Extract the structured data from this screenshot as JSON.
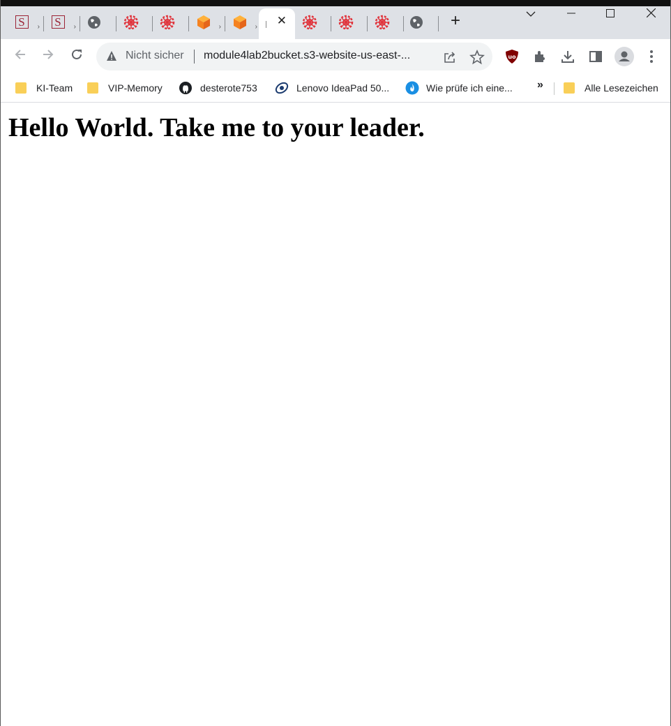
{
  "browser": {
    "tabs": [
      {
        "icon": "s-logo-icon",
        "title": "S",
        "active": false
      },
      {
        "icon": "s-logo-icon",
        "title": "S",
        "active": false
      },
      {
        "icon": "globe-icon",
        "title": "",
        "active": false
      },
      {
        "icon": "aws-wheel-icon",
        "title": "",
        "active": false
      },
      {
        "icon": "aws-wheel-icon",
        "title": "",
        "active": false
      },
      {
        "icon": "cube-icon",
        "title": "",
        "active": false
      },
      {
        "icon": "cube-icon",
        "title": "",
        "active": false
      },
      {
        "icon": "blank-page-icon",
        "title": "",
        "active": true
      },
      {
        "icon": "aws-wheel-icon",
        "title": "",
        "active": false
      },
      {
        "icon": "aws-wheel-icon",
        "title": "",
        "active": false
      },
      {
        "icon": "aws-wheel-icon",
        "title": "",
        "active": false
      },
      {
        "icon": "globe-icon",
        "title": "",
        "active": false
      }
    ],
    "omnibox": {
      "security_label": "Nicht sicher",
      "url": "module4lab2bucket.s3-website-us-east-..."
    },
    "bookmarks": [
      {
        "label": "KI-Team",
        "icon": "folder-icon"
      },
      {
        "label": "VIP-Memory",
        "icon": "folder-icon"
      },
      {
        "label": "desterote753",
        "icon": "github-icon"
      },
      {
        "label": "Lenovo IdeaPad 50...",
        "icon": "lenovo-icon"
      },
      {
        "label": "Wie prüfe ich eine...",
        "icon": "flame-icon"
      }
    ],
    "bookmarks_overflow": "»",
    "all_bookmarks": "Alle Lesezeichen"
  },
  "page": {
    "heading": "Hello World. Take me to your leader."
  }
}
